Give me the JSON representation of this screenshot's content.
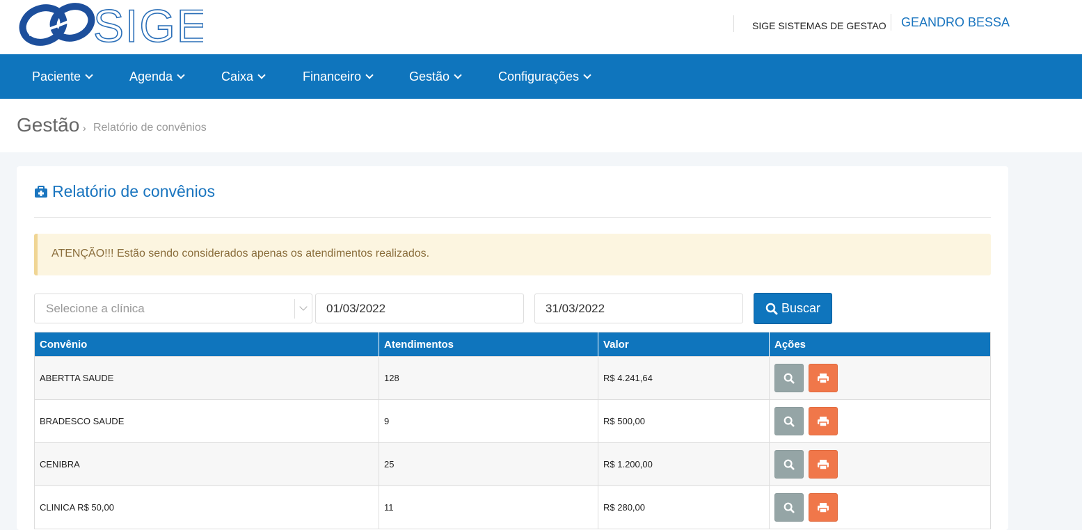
{
  "header": {
    "logo_text": "SIGE",
    "company": "SIGE SISTEMAS DE GESTAO",
    "user": "GEANDRO BESSA"
  },
  "nav": [
    {
      "label": "Paciente"
    },
    {
      "label": "Agenda"
    },
    {
      "label": "Caixa"
    },
    {
      "label": "Financeiro"
    },
    {
      "label": "Gestão"
    },
    {
      "label": "Configurações"
    }
  ],
  "breadcrumb": {
    "main": "Gestão",
    "separator": "›",
    "sub": "Relatório de convênios"
  },
  "card": {
    "title": "Relatório de convênios",
    "icon": "medkit-icon",
    "alert": "ATENÇÃO!!! Estão sendo considerados apenas os atendimentos realizados."
  },
  "filters": {
    "clinic_placeholder": "Selecione a clínica",
    "date_start": "01/03/2022",
    "date_end": "31/03/2022",
    "search_label": "Buscar"
  },
  "table": {
    "headers": [
      "Convênio",
      "Atendimentos",
      "Valor",
      "Ações"
    ],
    "rows": [
      {
        "convenio": "ABERTTA SAUDE",
        "atendimentos": "128",
        "valor": "R$ 4.241,64"
      },
      {
        "convenio": "BRADESCO SAUDE",
        "atendimentos": "9",
        "valor": "R$ 500,00"
      },
      {
        "convenio": "CENIBRA",
        "atendimentos": "25",
        "valor": "R$ 1.200,00"
      },
      {
        "convenio": "CLINICA R$ 50,00",
        "atendimentos": "11",
        "valor": "R$ 280,00"
      }
    ]
  },
  "colors": {
    "primary": "#0f75bd",
    "action_view": "#95a5a6",
    "action_print": "#f0774a",
    "alert_bg": "#fcf5e0"
  }
}
